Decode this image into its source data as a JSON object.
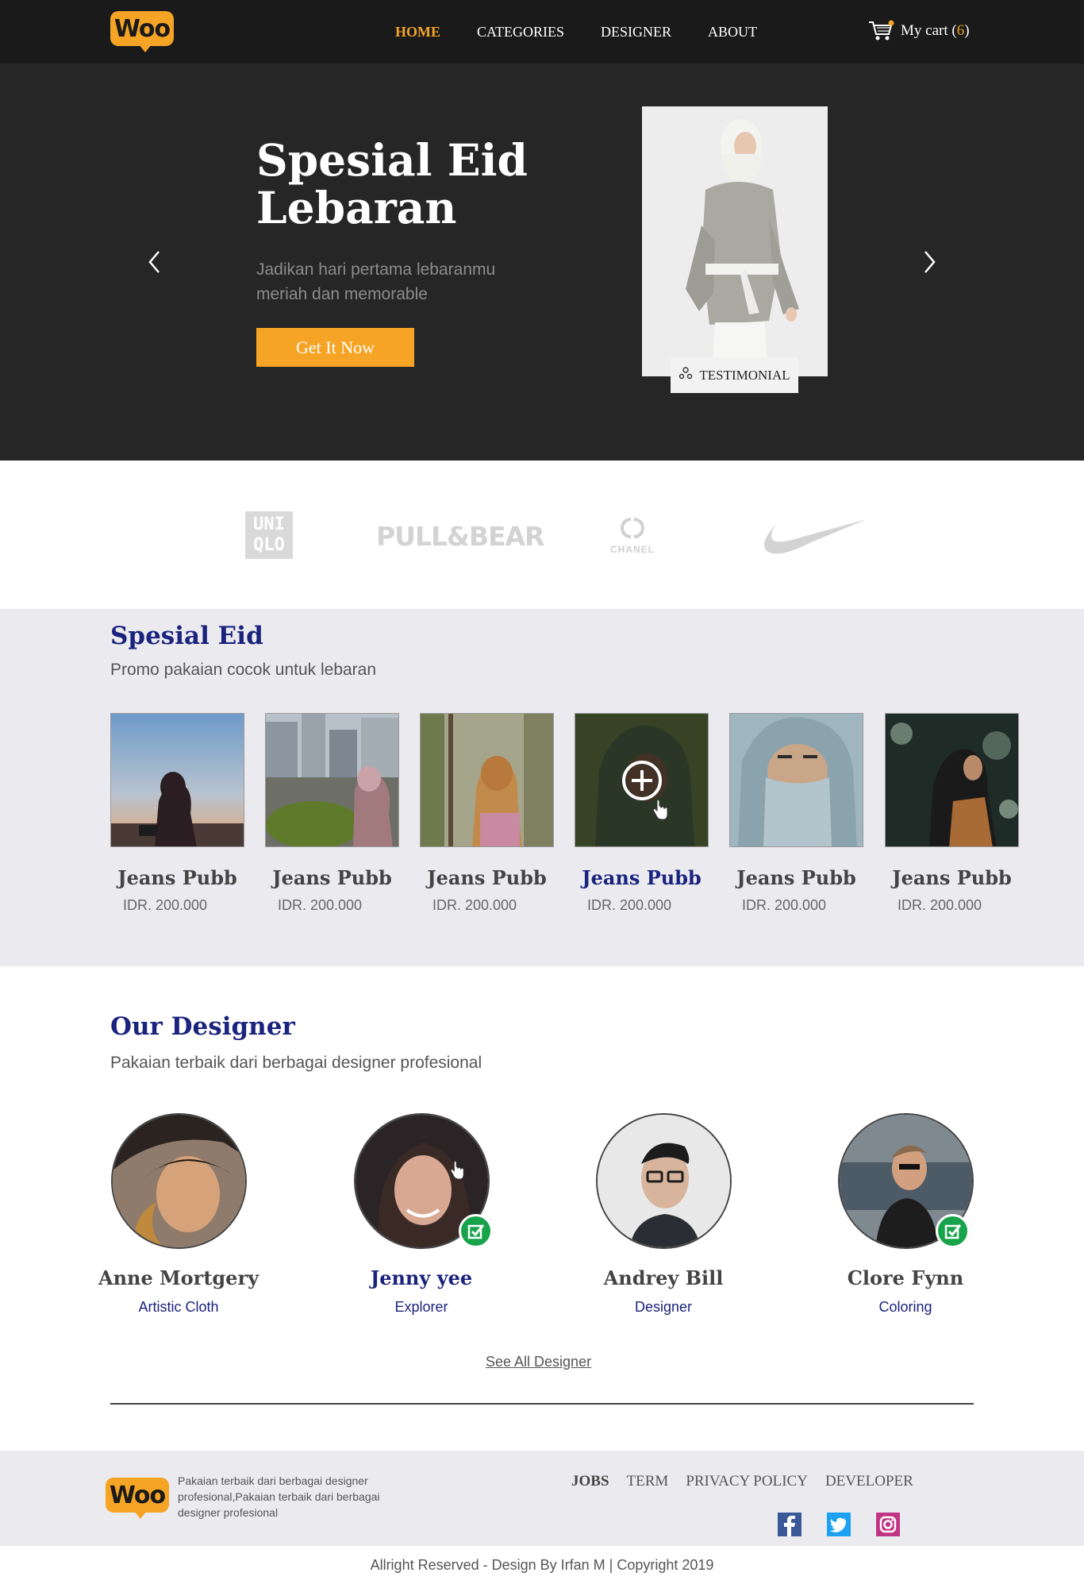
{
  "nav": {
    "logo": "Woo",
    "links": [
      "HOME",
      "CATEGORIES",
      "DESIGNER",
      "ABOUT"
    ],
    "cart_label": "My cart (",
    "cart_count": "6",
    "cart_close": ")"
  },
  "hero": {
    "title": "Spesial Eid Lebaran",
    "subtitle": "Jadikan hari pertama lebaranmu meriah dan memorable",
    "cta": "Get It Now",
    "badge": "TESTIMONIAL"
  },
  "brands": {
    "uniqlo_top": "UNI",
    "uniqlo_bottom": "QLO",
    "pullbear": "PULL&BEAR",
    "chanel": "CHANEL"
  },
  "special": {
    "title": "Spesial Eid",
    "subtitle": "Promo pakaian cocok untuk lebaran",
    "products": [
      {
        "name": "Jeans Pubb",
        "price": "IDR. 200.000"
      },
      {
        "name": "Jeans Pubb",
        "price": "IDR. 200.000"
      },
      {
        "name": "Jeans Pubb",
        "price": "IDR. 200.000"
      },
      {
        "name": "Jeans Pubb",
        "price": "IDR. 200.000"
      },
      {
        "name": "Jeans Pubb",
        "price": "IDR. 200.000"
      },
      {
        "name": "Jeans Pubb",
        "price": "IDR. 200.000"
      }
    ]
  },
  "designers": {
    "title": "Our Designer",
    "subtitle": "Pakaian terbaik dari berbagai designer profesional",
    "items": [
      {
        "name": "Anne Mortgery",
        "role": "Artistic Cloth"
      },
      {
        "name": "Jenny yee",
        "role": "Explorer"
      },
      {
        "name": "Andrey Bill",
        "role": "Designer"
      },
      {
        "name": "Clore Fynn",
        "role": "Coloring"
      }
    ],
    "see_all": "See All Designer"
  },
  "footer": {
    "logo": "Woo",
    "description": "Pakaian terbaik dari berbagai designer profesional,Pakaian terbaik dari berbagai designer profesional",
    "links": [
      "JOBS",
      "TERM",
      "PRIVACY POLICY",
      "DEVELOPER"
    ],
    "copyright": "Allright Reserved - Design By Irfan M | Copyright 2019"
  },
  "colors": {
    "accent": "#f5a425",
    "navy": "#1a237e",
    "dark": "#1a1a1a",
    "hero_bg": "#262626",
    "section_bg": "#ebebef",
    "check_green": "#17a34a"
  },
  "icons": [
    "cart-icon",
    "chevron-left-icon",
    "chevron-right-icon",
    "user-group-icon",
    "plus-circle-icon",
    "hand-pointer-icon",
    "check-badge-icon",
    "facebook-icon",
    "twitter-icon",
    "instagram-icon"
  ]
}
